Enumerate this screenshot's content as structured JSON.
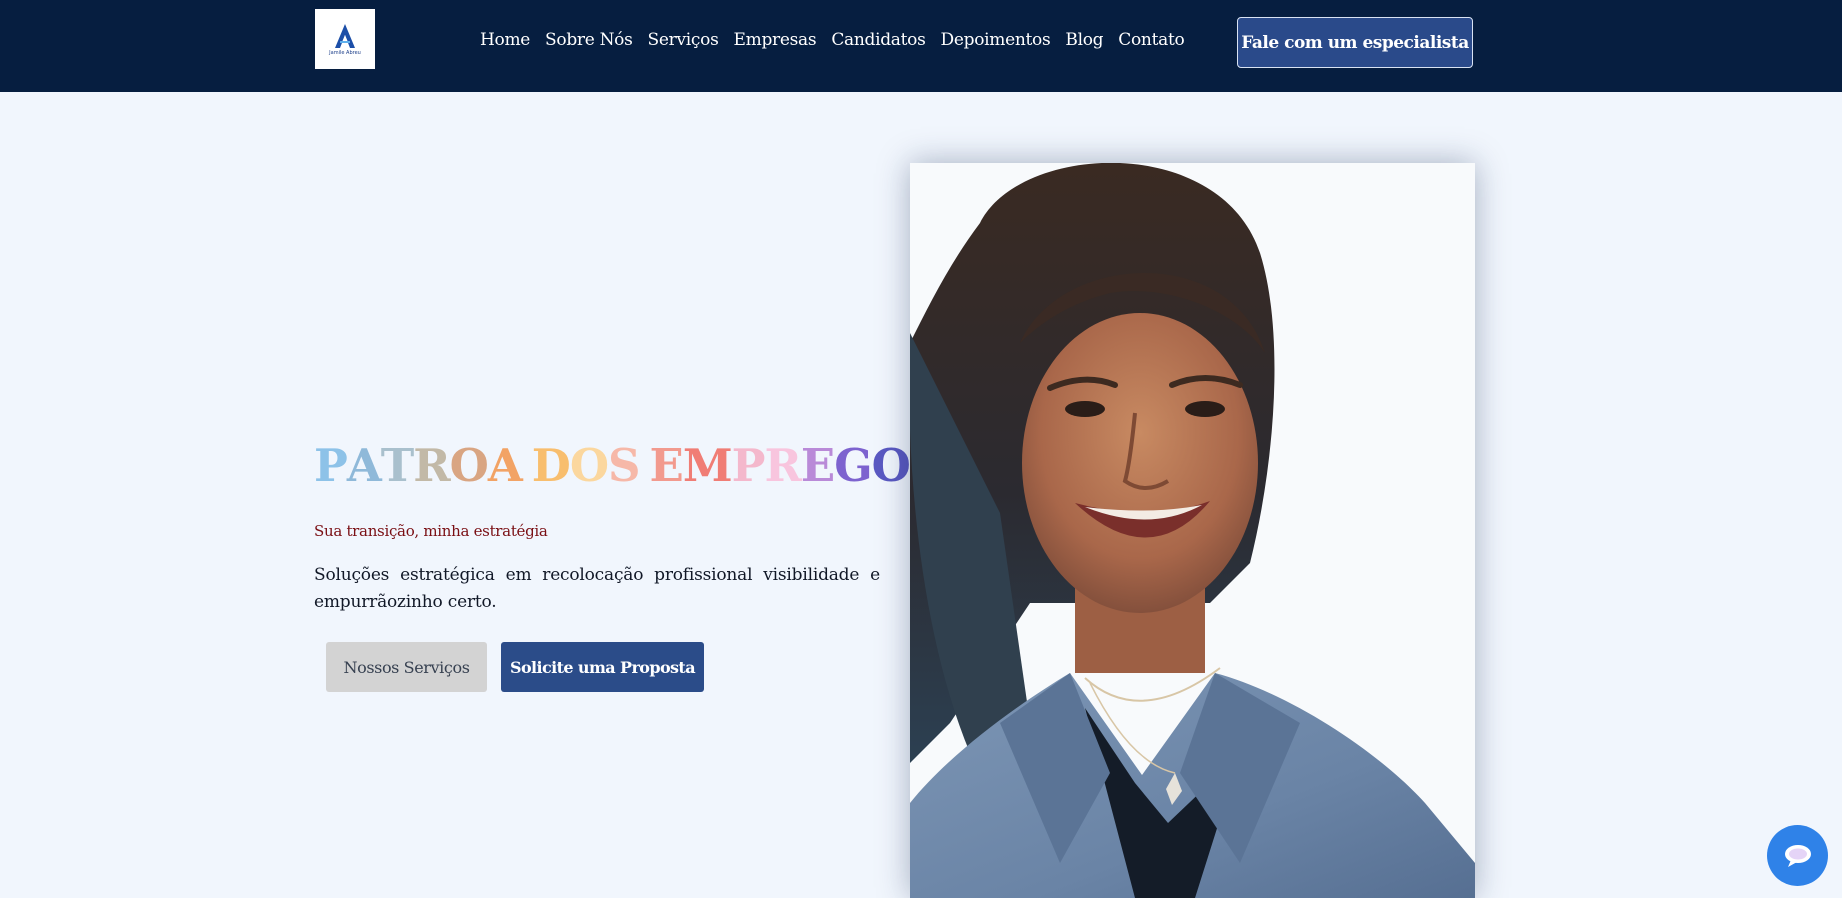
{
  "header": {
    "logo_text": "Jamile Abreu",
    "nav": [
      "Home",
      "Sobre Nós",
      "Serviços",
      "Empresas",
      "Candidatos",
      "Depoimentos",
      "Blog",
      "Contato"
    ],
    "cta_label": "Fale com um especialista"
  },
  "hero": {
    "title": "PATROA DOS EMPREGOS",
    "title_colors": [
      "#8dc2e8",
      "#8fb9d9",
      "#a9c0cd",
      "#c2b9a7",
      "#d9a582",
      "#f2a365",
      "#f8be6e",
      "#fbd79e",
      "#f6b8a8",
      "#f29a8e",
      "#f07d75",
      "#f4b8cc",
      "#f8c5de",
      "#b98ad8",
      "#7d63cf",
      "#5a59c2",
      "#4e59bf",
      "#3f6ad0",
      "#3a78d7",
      "#3087e0",
      "#25aadf",
      "#7ccbed"
    ],
    "subtitle": "Sua transição, minha estratégia",
    "description": "Soluções estratégica em recolocação profissional visibilidade e empurrãozinho certo.",
    "btn_services": "Nossos Serviços",
    "btn_proposal": "Solicite uma Proposta"
  },
  "icons": {
    "logo": "letter-a-logo-icon",
    "chat": "chat-bubble-icon"
  },
  "colors": {
    "header_bg": "#061e40",
    "page_bg": "#f1f6fd",
    "accent": "#2b4c89",
    "subtitle": "#7a0f14",
    "chat": "#2f82e8"
  }
}
